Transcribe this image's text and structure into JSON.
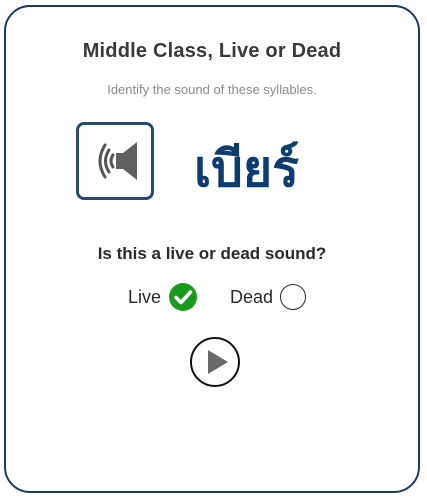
{
  "title": "Middle Class, Live or Dead",
  "subtitle": "Identify the sound of these syllables.",
  "word": "เบียร์",
  "question": "Is this a live or dead sound?",
  "options": [
    {
      "label": "Live",
      "selected": true
    },
    {
      "label": "Dead",
      "selected": false
    }
  ],
  "icons": {
    "speaker": "speaker-icon",
    "check": "check-icon",
    "play": "play-icon"
  },
  "colors": {
    "card_border": "#1e3a5f",
    "word": "#0d3d6e",
    "selected": "#1a9a1a"
  }
}
